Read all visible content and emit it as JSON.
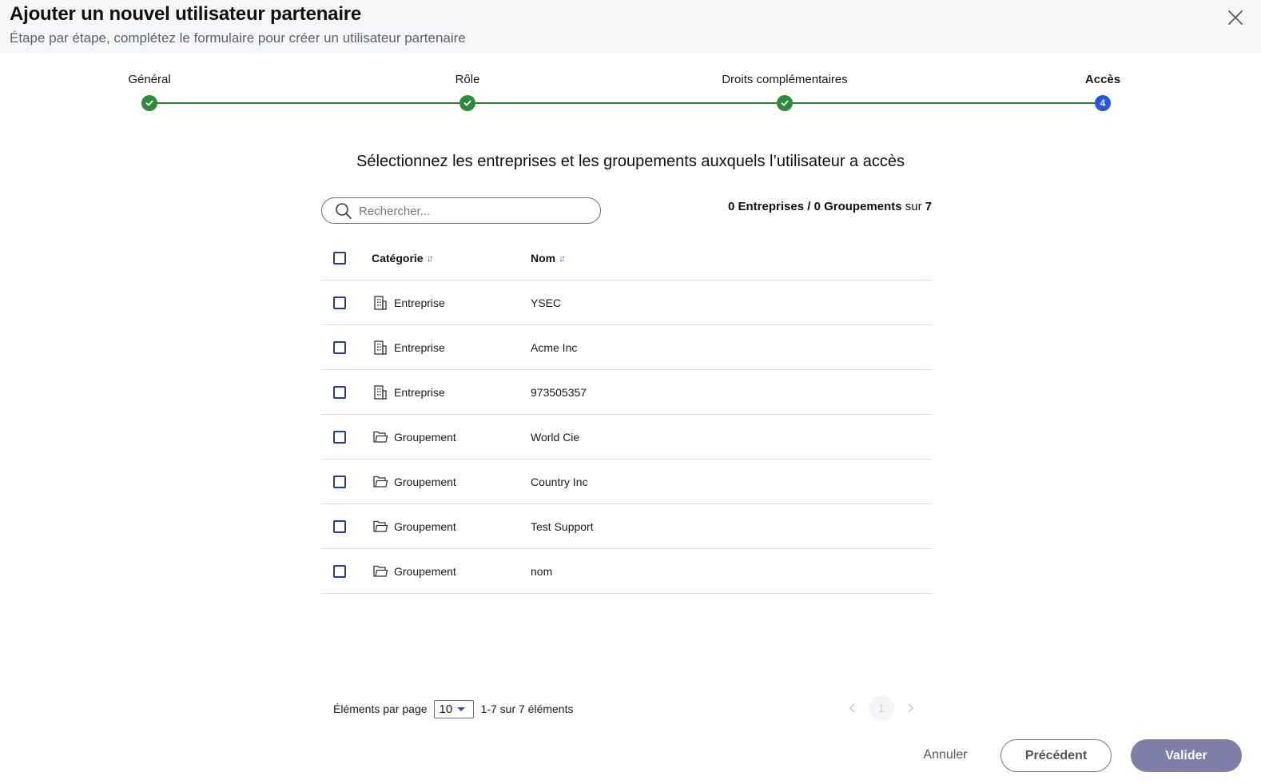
{
  "dialog": {
    "title": "Ajouter un nouvel utilisateur partenaire",
    "subtitle": "Étape par étape, complétez le formulaire pour créer un utilisateur partenaire",
    "close_icon": "close-icon"
  },
  "stepper": {
    "steps": [
      {
        "label": "Général",
        "status": "done"
      },
      {
        "label": "Rôle",
        "status": "done"
      },
      {
        "label": "Droits complémentaires",
        "status": "done"
      },
      {
        "label": "Accès",
        "status": "current",
        "number": "4"
      }
    ],
    "done_color": "#2e8b3a",
    "current_color": "#2854e6",
    "line_color": "#2e7d32"
  },
  "access": {
    "instruction": "Sélectionnez les entreprises et les groupements auxquels l’utilisateur a accès",
    "search": {
      "placeholder": "Rechercher...",
      "value": ""
    },
    "counter": {
      "entreprises": "0 Entreprises",
      "separator": " / ",
      "groupements": "0 Groupements",
      "sur": " sur ",
      "total": "7"
    }
  },
  "table": {
    "columns": [
      {
        "label": "Catégorie",
        "sort_icon": "sort-icon"
      },
      {
        "label": "Nom",
        "sort_icon": "sort-icon"
      }
    ],
    "rows": [
      {
        "category": "Entreprise",
        "icon": "building-icon",
        "name": "YSEC"
      },
      {
        "category": "Entreprise",
        "icon": "building-icon",
        "name": "Acme Inc"
      },
      {
        "category": "Entreprise",
        "icon": "building-icon",
        "name": "973505357"
      },
      {
        "category": "Groupement",
        "icon": "folder-icon",
        "name": "World Cie"
      },
      {
        "category": "Groupement",
        "icon": "folder-icon",
        "name": "Country Inc"
      },
      {
        "category": "Groupement",
        "icon": "folder-icon",
        "name": "Test Support"
      },
      {
        "category": "Groupement",
        "icon": "folder-icon",
        "name": "nom"
      }
    ]
  },
  "pagination": {
    "per_page_label": "Éléments par page",
    "per_page_value": "10",
    "range": "1-7 sur 7 éléments",
    "current_page": "1",
    "prev_icon": "chevron-left-icon",
    "next_icon": "chevron-right-icon"
  },
  "footer": {
    "cancel_label": "Annuler",
    "previous_label": "Précédent",
    "submit_label": "Valider",
    "submit_color": "#7d7fa8"
  }
}
